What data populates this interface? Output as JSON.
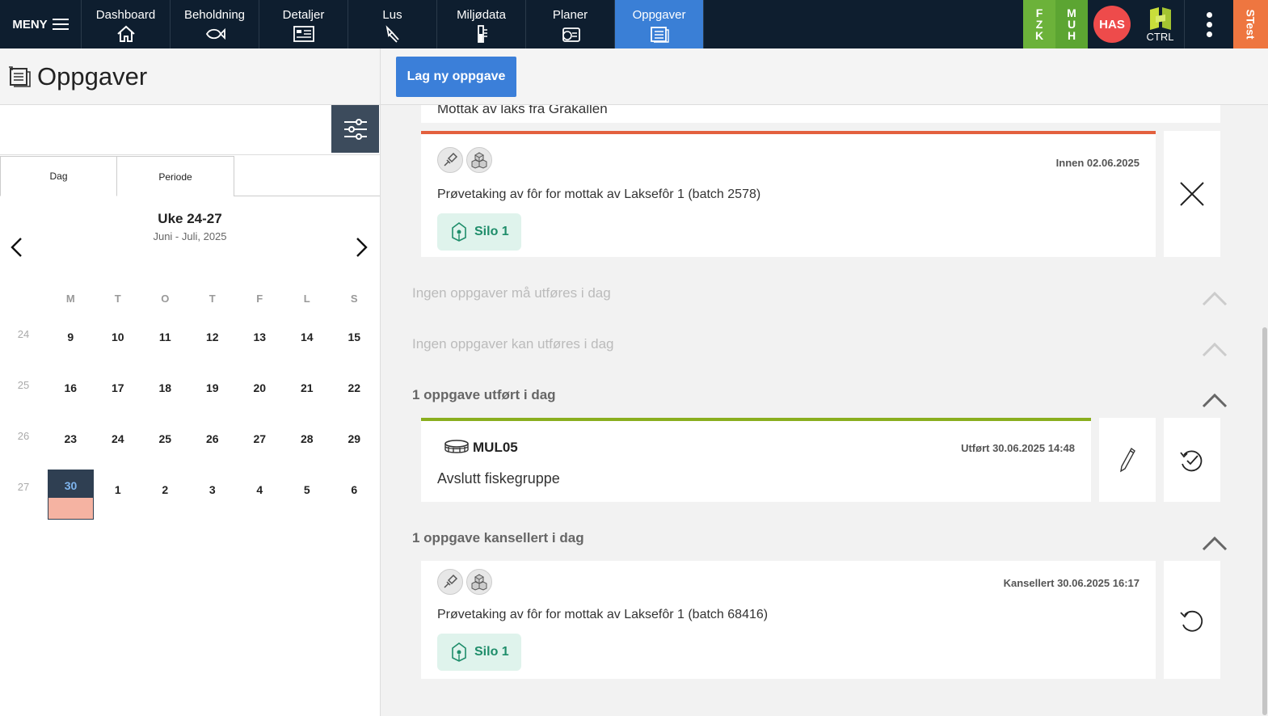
{
  "nav": {
    "menu_label": "MENY",
    "tabs": [
      {
        "label": "Dashboard",
        "icon": "home-icon"
      },
      {
        "label": "Beholdning",
        "icon": "fish-icon"
      },
      {
        "label": "Detaljer",
        "icon": "details-icon"
      },
      {
        "label": "Lus",
        "icon": "lice-icon"
      },
      {
        "label": "Miljødata",
        "icon": "thermometer-icon"
      },
      {
        "label": "Planer",
        "icon": "planner-icon"
      },
      {
        "label": "Oppgaver",
        "icon": "tasks-icon"
      }
    ],
    "active_tab": "Oppgaver",
    "badge_fzk": [
      "F",
      "Z",
      "K"
    ],
    "badge_muh": [
      "M",
      "U",
      "H"
    ],
    "avatar": "HAS",
    "ctrl_label": "CTRL",
    "env_label": "STest",
    "colors": {
      "bar": "#0e1e2f",
      "active": "#3a7fd6",
      "green": "#6cb23a",
      "avatar": "#ee4b4b",
      "env": "#ee7640"
    }
  },
  "left": {
    "title": "Oppgaver",
    "tabs": [
      "Dag",
      "Periode"
    ],
    "calendar": {
      "week": "Uke 24-27",
      "range": "Juni - Juli, 2025",
      "dow": [
        "M",
        "T",
        "O",
        "T",
        "F",
        "L",
        "S"
      ],
      "weeks": [
        {
          "wk": "24",
          "days": [
            "9",
            "10",
            "11",
            "12",
            "13",
            "14",
            "15"
          ]
        },
        {
          "wk": "25",
          "days": [
            "16",
            "17",
            "18",
            "19",
            "20",
            "21",
            "22"
          ]
        },
        {
          "wk": "26",
          "days": [
            "23",
            "24",
            "25",
            "26",
            "27",
            "28",
            "29"
          ]
        },
        {
          "wk": "27",
          "days": [
            "30",
            "1",
            "2",
            "3",
            "4",
            "5",
            "6"
          ]
        }
      ],
      "today": "30"
    }
  },
  "right": {
    "new_task_button": "Lag ny oppgave",
    "partial_card_title": "Mottak av laks fra Gråkallen",
    "card_open": {
      "date": "Innen 02.06.2025",
      "title": "Prøvetaking av fôr for mottak av Laksefôr 1 (batch 2578)",
      "chip": "Silo 1"
    },
    "section_must": "Ingen oppgaver må utføres i dag",
    "section_can": "Ingen oppgaver kan utføres i dag",
    "section_done": "1 oppgave utført i dag",
    "card_done": {
      "unit": "MUL05",
      "date": "Utført 30.06.2025 14:48",
      "title": "Avslutt fiskegruppe"
    },
    "section_cancelled": "1 oppgave kansellert i dag",
    "card_cancelled": {
      "date": "Kansellert 30.06.2025 16:17",
      "title": "Prøvetaking av fôr for mottak av Laksefôr 1 (batch 68416)",
      "chip": "Silo 1"
    }
  }
}
